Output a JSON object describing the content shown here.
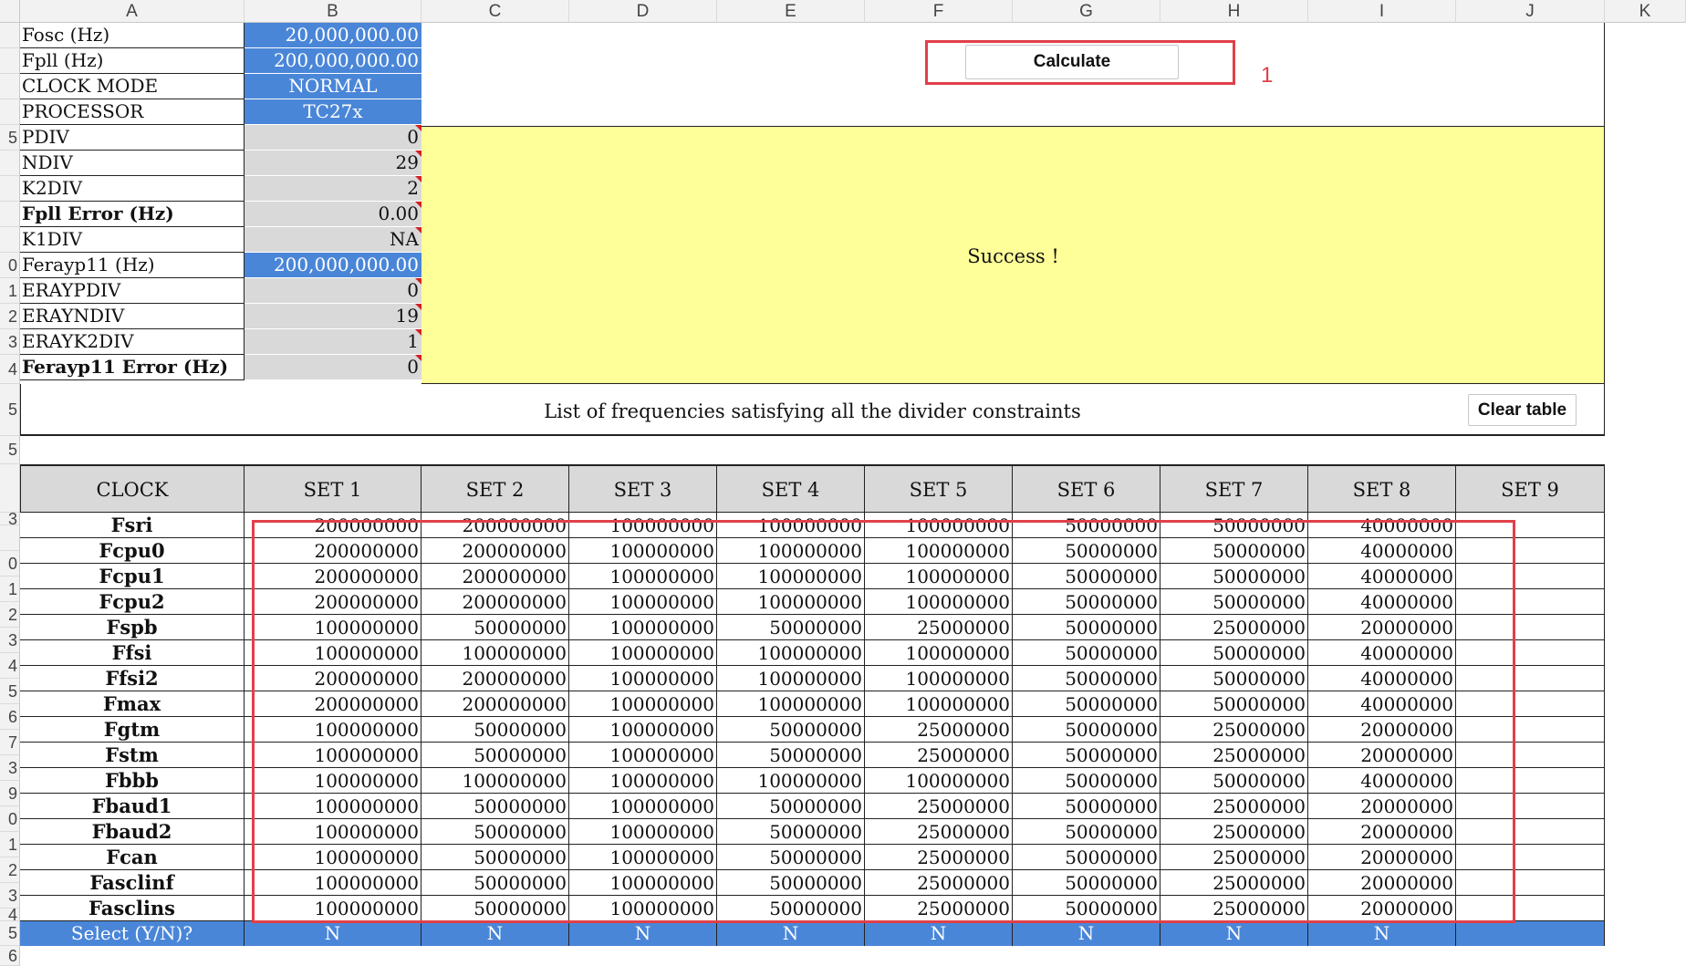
{
  "columns": [
    "A",
    "B",
    "C",
    "D",
    "E",
    "F",
    "G",
    "H",
    "I",
    "J",
    "K"
  ],
  "row_numbers": [
    "",
    "",
    "",
    "",
    "5",
    "",
    "",
    "",
    "",
    "0",
    "1",
    "2",
    "3",
    "4",
    "5",
    "5",
    "",
    "3",
    "",
    "0",
    "1",
    "2",
    "3",
    "4",
    "5",
    "6",
    "7",
    "3",
    "9",
    "0",
    "1",
    "2",
    "3",
    "4",
    "5",
    "6",
    ""
  ],
  "params": [
    {
      "label": "Fosc (Hz)",
      "value": "20,000,000.00",
      "style": "blue"
    },
    {
      "label": "Fpll (Hz)",
      "value": "200,000,000.00",
      "style": "blue"
    },
    {
      "label": "CLOCK MODE",
      "value": "NORMAL",
      "style": "blue-center"
    },
    {
      "label": "PROCESSOR",
      "value": "TC27x",
      "style": "blue-center"
    },
    {
      "label": "PDIV",
      "value": "0",
      "style": "gray"
    },
    {
      "label": "NDIV",
      "value": "29",
      "style": "gray"
    },
    {
      "label": "K2DIV",
      "value": "2",
      "style": "gray"
    },
    {
      "label": "Fpll Error (Hz)",
      "value": "0.00",
      "style": "gray",
      "bold": true
    },
    {
      "label": "K1DIV",
      "value": "NA",
      "style": "gray"
    },
    {
      "label": "Ferayp11 (Hz)",
      "value": "200,000,000.00",
      "style": "blue"
    },
    {
      "label": "ERAYPDIV",
      "value": "0",
      "style": "gray"
    },
    {
      "label": "ERAYNDIV",
      "value": "19",
      "style": "gray"
    },
    {
      "label": "ERAYK2DIV",
      "value": "1",
      "style": "gray"
    },
    {
      "label": "Ferayp11 Error (Hz)",
      "value": "0",
      "style": "gray",
      "bold": true
    }
  ],
  "calculate_button": "Calculate",
  "annotation_number": "1",
  "status_message": "Success !",
  "list_title": "List of frequencies satisfying all the divider constraints",
  "clear_button": "Clear table",
  "colors": {
    "blue": "#4a86d8",
    "yellow": "#ffff99",
    "gray": "#d9d9d9",
    "red": "#e0404a"
  },
  "table": {
    "header": [
      "CLOCK",
      "SET 1",
      "SET 2",
      "SET 3",
      "SET 4",
      "SET 5",
      "SET 6",
      "SET 7",
      "SET 8",
      "SET 9"
    ],
    "rows": [
      {
        "clock": "Fsri",
        "values": [
          "200000000",
          "200000000",
          "100000000",
          "100000000",
          "100000000",
          "50000000",
          "50000000",
          "40000000",
          ""
        ]
      },
      {
        "clock": "Fcpu0",
        "values": [
          "200000000",
          "200000000",
          "100000000",
          "100000000",
          "100000000",
          "50000000",
          "50000000",
          "40000000",
          ""
        ]
      },
      {
        "clock": "Fcpu1",
        "values": [
          "200000000",
          "200000000",
          "100000000",
          "100000000",
          "100000000",
          "50000000",
          "50000000",
          "40000000",
          ""
        ]
      },
      {
        "clock": "Fcpu2",
        "values": [
          "200000000",
          "200000000",
          "100000000",
          "100000000",
          "100000000",
          "50000000",
          "50000000",
          "40000000",
          ""
        ]
      },
      {
        "clock": "Fspb",
        "values": [
          "100000000",
          "50000000",
          "100000000",
          "50000000",
          "25000000",
          "50000000",
          "25000000",
          "20000000",
          ""
        ]
      },
      {
        "clock": "Ffsi",
        "values": [
          "100000000",
          "100000000",
          "100000000",
          "100000000",
          "100000000",
          "50000000",
          "50000000",
          "40000000",
          ""
        ]
      },
      {
        "clock": "Ffsi2",
        "values": [
          "200000000",
          "200000000",
          "100000000",
          "100000000",
          "100000000",
          "50000000",
          "50000000",
          "40000000",
          ""
        ]
      },
      {
        "clock": "Fmax",
        "values": [
          "200000000",
          "200000000",
          "100000000",
          "100000000",
          "100000000",
          "50000000",
          "50000000",
          "40000000",
          ""
        ]
      },
      {
        "clock": "Fgtm",
        "values": [
          "100000000",
          "50000000",
          "100000000",
          "50000000",
          "25000000",
          "50000000",
          "25000000",
          "20000000",
          ""
        ]
      },
      {
        "clock": "Fstm",
        "values": [
          "100000000",
          "50000000",
          "100000000",
          "50000000",
          "25000000",
          "50000000",
          "25000000",
          "20000000",
          ""
        ]
      },
      {
        "clock": "Fbbb",
        "values": [
          "100000000",
          "100000000",
          "100000000",
          "100000000",
          "100000000",
          "50000000",
          "50000000",
          "40000000",
          ""
        ]
      },
      {
        "clock": "Fbaud1",
        "values": [
          "100000000",
          "50000000",
          "100000000",
          "50000000",
          "25000000",
          "50000000",
          "25000000",
          "20000000",
          ""
        ]
      },
      {
        "clock": "Fbaud2",
        "values": [
          "100000000",
          "50000000",
          "100000000",
          "50000000",
          "25000000",
          "50000000",
          "25000000",
          "20000000",
          ""
        ]
      },
      {
        "clock": "Fcan",
        "values": [
          "100000000",
          "50000000",
          "100000000",
          "50000000",
          "25000000",
          "50000000",
          "25000000",
          "20000000",
          ""
        ]
      },
      {
        "clock": "Fasclinf",
        "values": [
          "100000000",
          "50000000",
          "100000000",
          "50000000",
          "25000000",
          "50000000",
          "25000000",
          "20000000",
          ""
        ]
      },
      {
        "clock": "Fasclins",
        "values": [
          "100000000",
          "50000000",
          "100000000",
          "50000000",
          "25000000",
          "50000000",
          "25000000",
          "20000000",
          ""
        ]
      }
    ],
    "select_label": "Select (Y/N)?",
    "select_values": [
      "N",
      "N",
      "N",
      "N",
      "N",
      "N",
      "N",
      "N",
      ""
    ]
  }
}
